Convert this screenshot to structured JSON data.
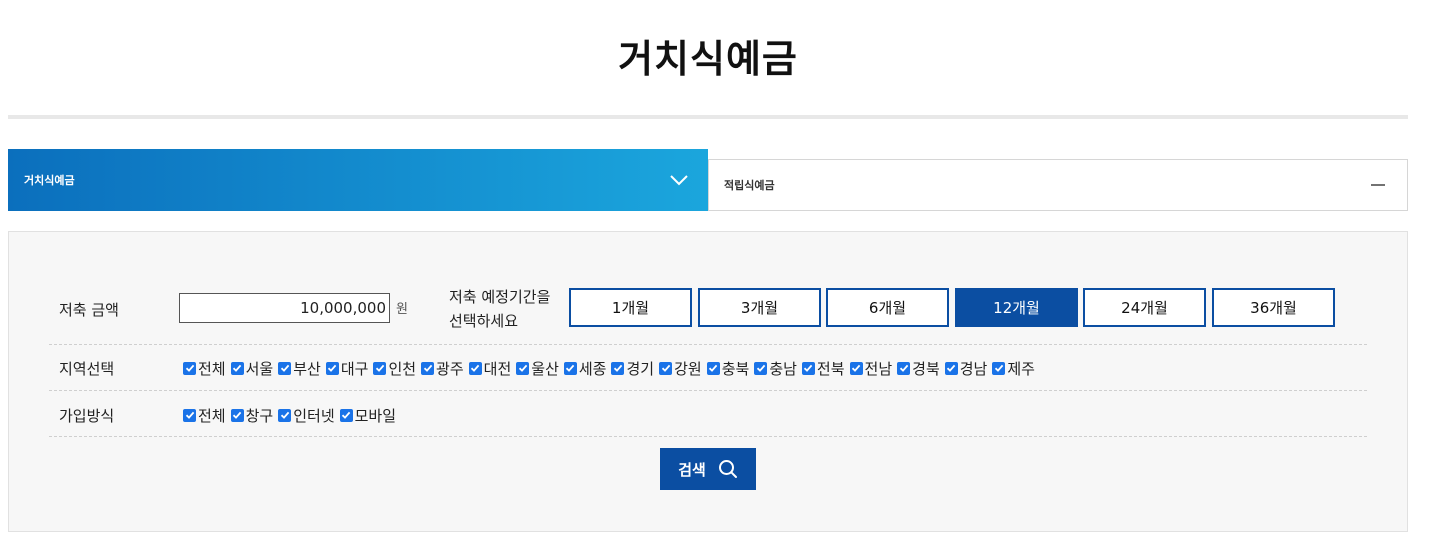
{
  "page": {
    "title": "거치식예금"
  },
  "tabs": [
    {
      "label": "거치식예금",
      "icon": "chevron-down-icon",
      "active": true
    },
    {
      "label": "적립식예금",
      "icon": "minus-icon",
      "active": false
    }
  ],
  "amount": {
    "label": "저축 금액",
    "value": "10,000,000",
    "unit": "원"
  },
  "period": {
    "label_line1": "저축 예정기간을",
    "label_line2": "선택하세요",
    "options": [
      "1개월",
      "3개월",
      "6개월",
      "12개월",
      "24개월",
      "36개월"
    ],
    "selected": "12개월"
  },
  "region": {
    "label": "지역선택",
    "options": [
      "전체",
      "서울",
      "부산",
      "대구",
      "인천",
      "광주",
      "대전",
      "울산",
      "세종",
      "경기",
      "강원",
      "충북",
      "충남",
      "전북",
      "전남",
      "경북",
      "경남",
      "제주"
    ]
  },
  "join_method": {
    "label": "가입방식",
    "options": [
      "전체",
      "창구",
      "인터넷",
      "모바일"
    ]
  },
  "search_button": {
    "label": "검색",
    "icon": "search-icon"
  },
  "colors": {
    "primary": "#0b4ea2",
    "tab_gradient_start": "#0b6fbd",
    "tab_gradient_end": "#1ba6dd",
    "checkbox": "#1a73e8"
  }
}
